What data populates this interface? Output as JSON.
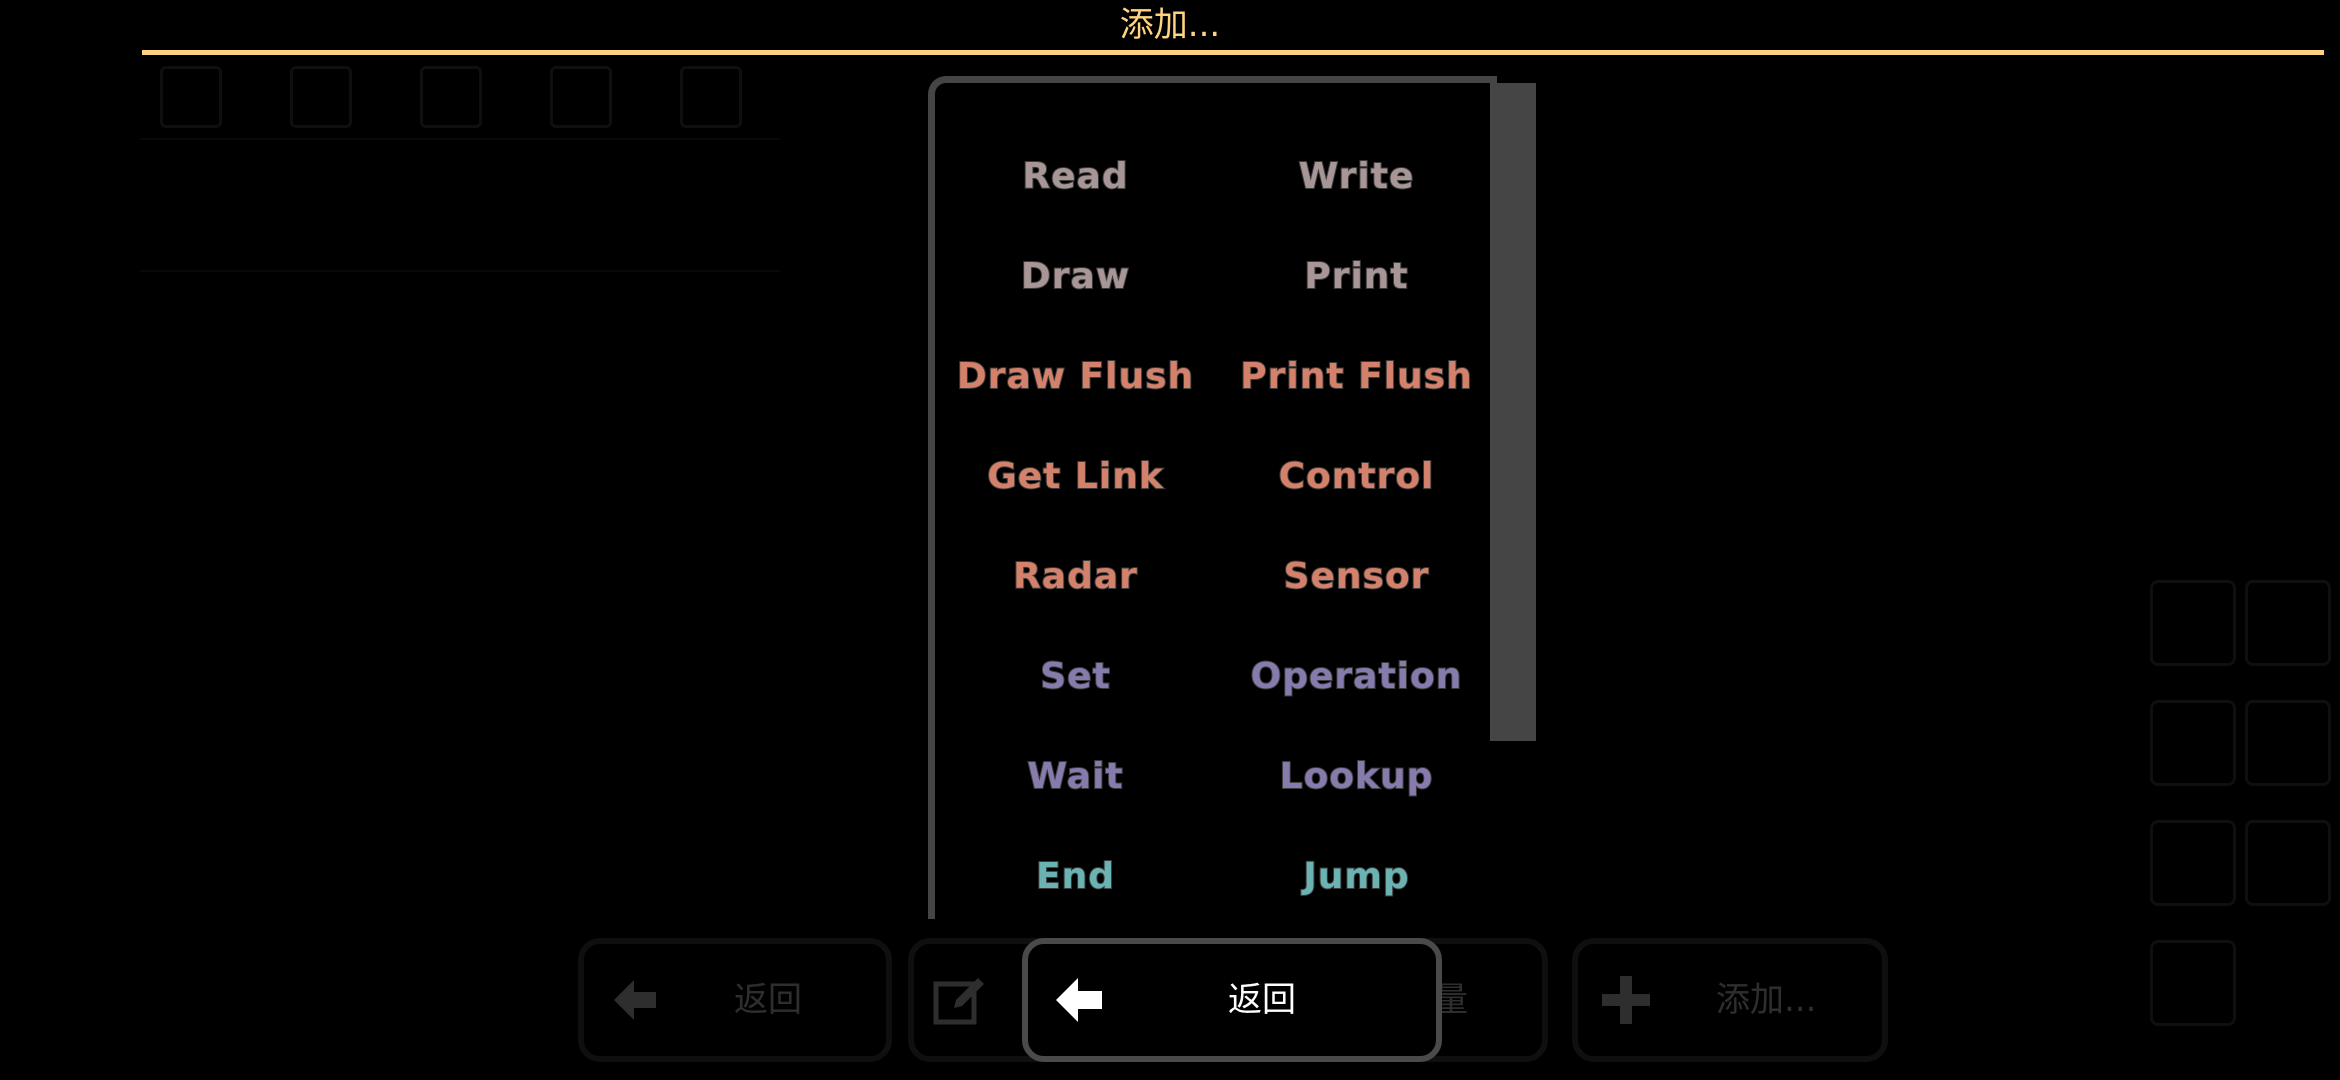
{
  "dialog": {
    "title": "添加..."
  },
  "colors": {
    "accent": "#ffd37f",
    "io": "#a89696",
    "block": "#d4816b",
    "operation": "#877bad",
    "flow": "#6bb2b2"
  },
  "items": [
    {
      "label": "Read",
      "group": "io"
    },
    {
      "label": "Write",
      "group": "io"
    },
    {
      "label": "Draw",
      "group": "io"
    },
    {
      "label": "Print",
      "group": "io"
    },
    {
      "label": "Draw Flush",
      "group": "block"
    },
    {
      "label": "Print Flush",
      "group": "block"
    },
    {
      "label": "Get Link",
      "group": "block"
    },
    {
      "label": "Control",
      "group": "block"
    },
    {
      "label": "Radar",
      "group": "block"
    },
    {
      "label": "Sensor",
      "group": "block"
    },
    {
      "label": "Set",
      "group": "operation"
    },
    {
      "label": "Operation",
      "group": "operation"
    },
    {
      "label": "Wait",
      "group": "operation"
    },
    {
      "label": "Lookup",
      "group": "operation"
    },
    {
      "label": "End",
      "group": "flow"
    },
    {
      "label": "Jump",
      "group": "flow"
    }
  ],
  "bottom_bar": {
    "back_label_bg": "返回",
    "vars_label_fragment": "量",
    "add_label": "添加...",
    "back_label": "返回"
  }
}
